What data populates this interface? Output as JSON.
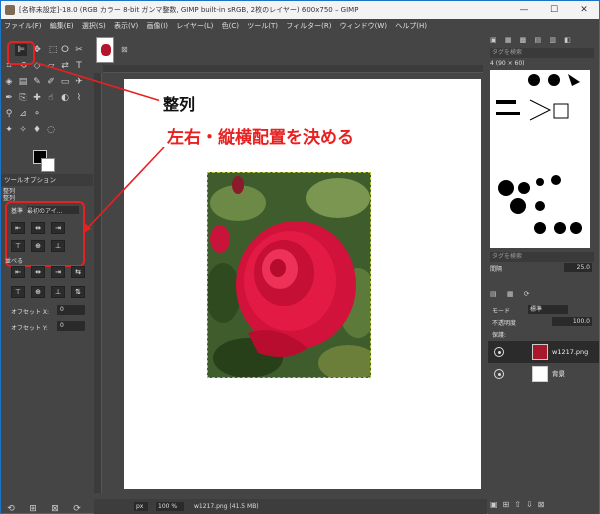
{
  "window": {
    "title": "[名称未設定]-18.0 (RGB カラー 8-bit ガンマ整数, GIMP built-in sRGB, 2枚のレイヤー) 600x750 – GIMP",
    "min_glyph": "—",
    "max_glyph": "☐",
    "close_glyph": "✕"
  },
  "menu": [
    "ファイル(F)",
    "編集(E)",
    "選択(S)",
    "表示(V)",
    "画像(I)",
    "レイヤー(L)",
    "色(C)",
    "ツール(T)",
    "フィルター(R)",
    "ウィンドウ(W)",
    "ヘルプ(H)"
  ],
  "toolbox": {
    "tab_label": "ツールオプション",
    "section_title": "整列",
    "subsection": "整列",
    "relative_label": "基準",
    "relative_value": "最初のアイ...",
    "distribute_label": "並べる",
    "offset_x_label": "オフセット X:",
    "offset_x_value": "0",
    "offset_y_label": "オフセット Y:",
    "offset_y_value": "0",
    "align_row1": [
      "⇤",
      "⇹",
      "⇥"
    ],
    "align_row2": [
      "⊤",
      "⊕",
      "⊥"
    ],
    "dist_row1": [
      "⇤",
      "⇹",
      "⇥",
      "⇆"
    ],
    "dist_row2": [
      "⊤",
      "⊕",
      "⊥",
      "⇅"
    ],
    "bottom_icons": [
      "⟲",
      "⊞",
      "⊠",
      "⟳"
    ]
  },
  "annotation": {
    "title": "整列",
    "description": "左右・縦横配置を決める",
    "accent_color": "#e82020"
  },
  "canvas": {
    "statusbar_unit": "px",
    "statusbar_zoom": "100 %",
    "statusbar_file": "w1217.png (41.5 MB)"
  },
  "right": {
    "brushes_title": "タグを検索",
    "brush_name": "4 (90 × 60)",
    "spacing_label": "間隔",
    "spacing_value": "25.0",
    "mode_label": "モード",
    "mode_value": "標準",
    "opacity_label": "不透明度",
    "opacity_value": "100.0",
    "lock_label": "保護:",
    "layers": [
      {
        "name": "w1217.png"
      },
      {
        "name": "背景"
      }
    ]
  }
}
